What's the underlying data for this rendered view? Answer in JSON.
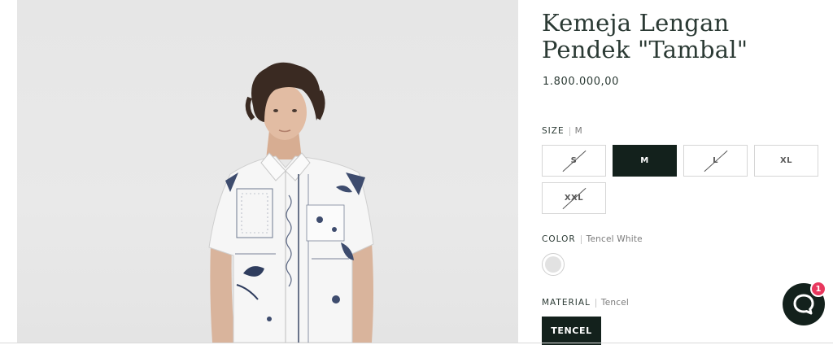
{
  "product": {
    "title_line1": "Kemeja Lengan",
    "title_line2": "Pendek \"Tambal\"",
    "price": "1.800.000,00"
  },
  "size": {
    "label": "SIZE",
    "selected_value": "M",
    "options": [
      {
        "label": "S",
        "available": false
      },
      {
        "label": "M",
        "available": true,
        "selected": true
      },
      {
        "label": "L",
        "available": false
      },
      {
        "label": "XL",
        "available": true
      },
      {
        "label": "XXL",
        "available": false
      }
    ]
  },
  "color": {
    "label": "COLOR",
    "selected_value": "Tencel White",
    "swatch_hex": "#e2e2e2"
  },
  "material": {
    "label": "MATERIAL",
    "selected_value": "Tencel",
    "option_label": "TENCEL"
  },
  "chat": {
    "icon": "chat-bubble-icon",
    "badge_count": "1"
  },
  "colors": {
    "accent_dark": "#13211c",
    "badge_red": "#e8375d",
    "title_text": "#2b3a34"
  }
}
